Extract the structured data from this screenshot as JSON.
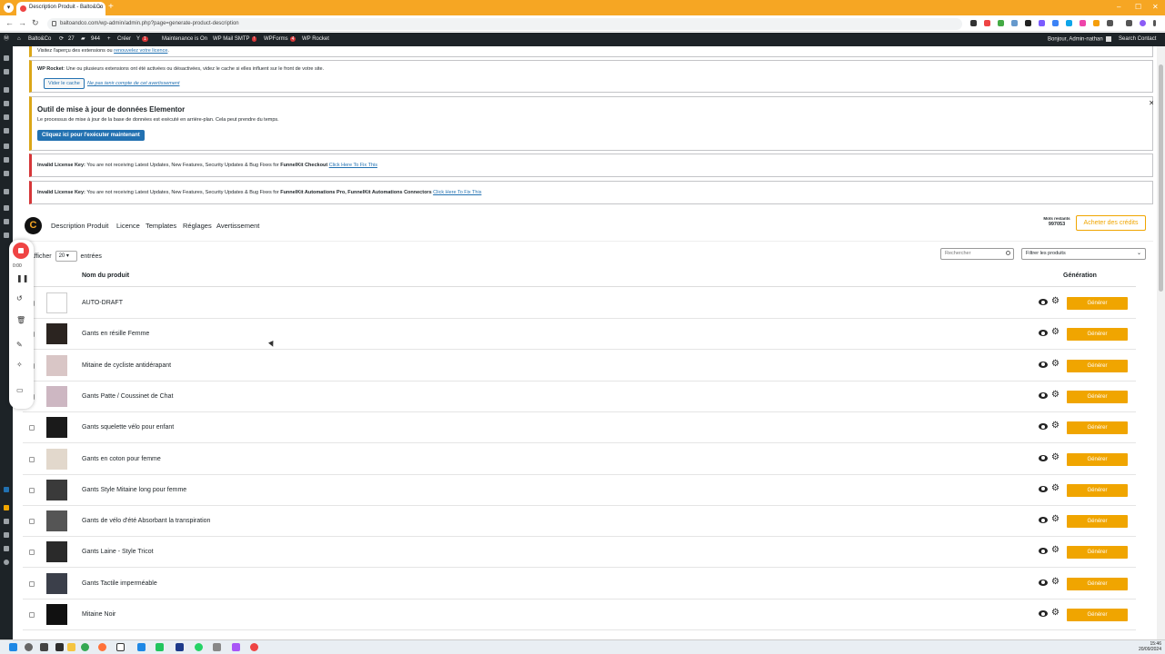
{
  "browser": {
    "tab_title": "Description Produit - Balto&Co",
    "url": "baltoandco.com/wp-admin/admin.php?page=generate-product-description",
    "new_tab": "+",
    "minimize": "–",
    "maximize": "☐",
    "close": "✕"
  },
  "adminbar": {
    "site": "Balto&Co",
    "updates": "27",
    "comments": "944",
    "create": "Créer",
    "maintenance": "Maintenance is On",
    "wp_mail": "WP Mail SMTP",
    "wp_mail_badge": "!",
    "wpforms": "WPForms",
    "wpforms_badge": "4",
    "wp_rocket": "WP Rocket",
    "yoast_badge": "1",
    "greeting": "Bonjour, Admin-nathan",
    "search_contact": "Search Contact"
  },
  "recorder": {
    "time": "0:00"
  },
  "notices": {
    "top_line": "Visitez l'aperçu des extensions ou ",
    "top_link": "renouvelez votre licence",
    "rocket_label": "WP Rocket",
    "rocket_text": ": Une ou plusieurs extensions ont été activées ou désactivées, videz le cache si elles influent sur le front de votre site.",
    "rocket_btn": "Vider le cache",
    "rocket_ignore": "Ne pas tenir compte de cet avertissement",
    "elementor_title": "Outil de mise à jour de données Elementor",
    "elementor_text": "Le processus de mise à jour de la base de données est exécuté en arrière-plan. Cela peut prendre du temps.",
    "elementor_btn": "Cliquez ici pour l'exécuter maintenant",
    "lic1_label": "Invalid License Key:",
    "lic1_text": " You are not receiving Latest Updates, New Features, Security Updates & Bug Fixes for ",
    "lic1_product": "FunnelKit Checkout",
    "lic1_link": "Click Here To Fix This",
    "lic2_label": "Invalid License Key:",
    "lic2_text": " You are not receiving Latest Updates, New Features, Security Updates & Bug Fixes for ",
    "lic2_product": "FunnelKit Automations Pro, FunnelKit Automations Connectors",
    "lic2_link": "Click Here To Fix This"
  },
  "plugin": {
    "logo": "C",
    "nav": [
      "Description Produit",
      "Licence",
      "Templates",
      "Réglages",
      "Avertissement"
    ],
    "credits_label": "Mots restants",
    "credits_value": "997053",
    "buy_btn": "Acheter des crédits"
  },
  "table_controls": {
    "show_label": "Afficher",
    "show_value": "20",
    "entries_label": "entrées",
    "search_placeholder": "Rechercher",
    "filter_value": "Filtrer les produits"
  },
  "table": {
    "col_name": "Nom du produit",
    "col_generation": "Génération",
    "generate_label": "Générer",
    "rows": [
      {
        "name": "AUTO-DRAFT",
        "thumb": "#ffffff"
      },
      {
        "name": "Gants en résille Femme",
        "thumb": "#2b2420"
      },
      {
        "name": "Mitaine de cycliste antidérapant",
        "thumb": "#d9c6c6"
      },
      {
        "name": "Gants Patte / Coussinet de Chat",
        "thumb": "#cdb7c2"
      },
      {
        "name": "Gants squelette vélo pour enfant",
        "thumb": "#1a1a1a"
      },
      {
        "name": "Gants en coton pour femme",
        "thumb": "#e2d8cc"
      },
      {
        "name": "Gants Style Mitaine long pour femme",
        "thumb": "#3a3a3a"
      },
      {
        "name": "Gants de vélo d'été Absorbant la transpiration",
        "thumb": "#555555"
      },
      {
        "name": "Gants Laine - Style Tricot",
        "thumb": "#2a2a2a"
      },
      {
        "name": "Gants Tactile imperméable",
        "thumb": "#3b3f4a"
      },
      {
        "name": "Mitaine Noir",
        "thumb": "#111111"
      }
    ]
  },
  "taskbar": {
    "time": "15:46",
    "date": "20/09/2024"
  }
}
